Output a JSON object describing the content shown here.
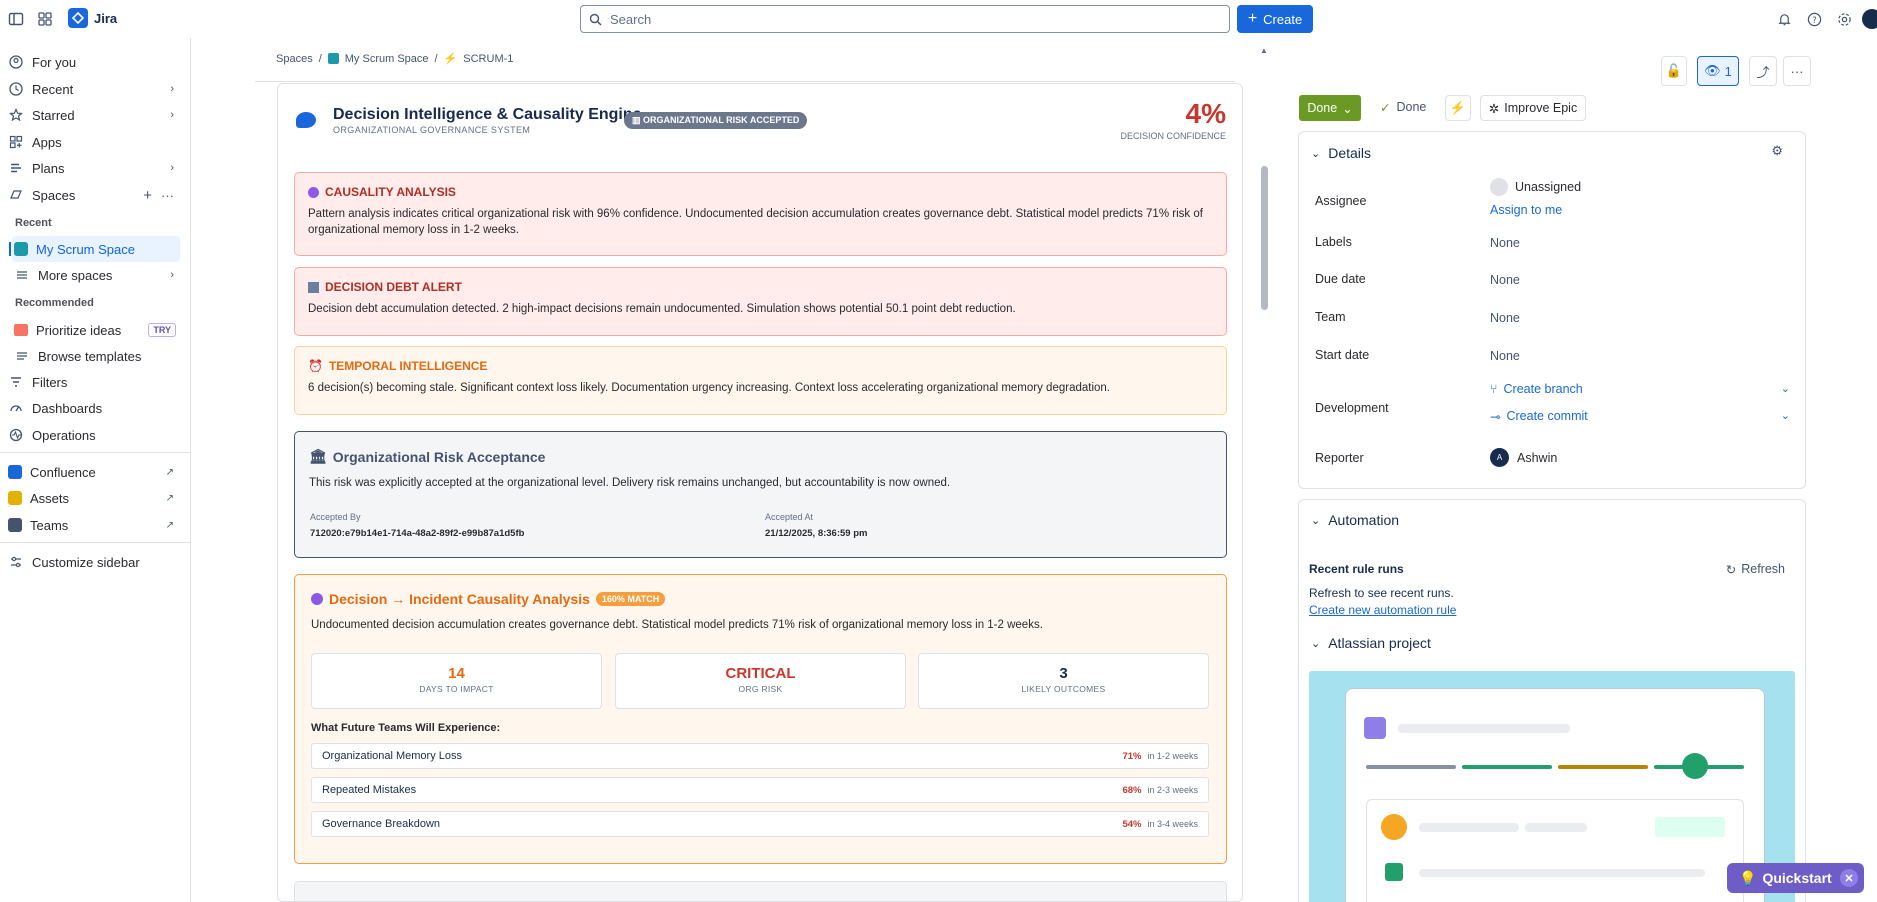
{
  "topbar": {
    "app_name": "Jira",
    "search_placeholder": "Search",
    "create_label": "Create"
  },
  "sidebar": {
    "items": [
      {
        "label": "For you"
      },
      {
        "label": "Recent"
      },
      {
        "label": "Starred"
      },
      {
        "label": "Apps"
      },
      {
        "label": "Plans"
      },
      {
        "label": "Spaces"
      }
    ],
    "recent_heading": "Recent",
    "recent_space": "My Scrum Space",
    "more_spaces": "More spaces",
    "recommended_heading": "Recommended",
    "prioritize": "Prioritize ideas",
    "try_badge": "TRY",
    "browse_templates": "Browse templates",
    "filters": "Filters",
    "dashboards": "Dashboards",
    "operations": "Operations",
    "confluence": "Confluence",
    "assets": "Assets",
    "teams": "Teams",
    "customize": "Customize sidebar"
  },
  "breadcrumb": {
    "spaces": "Spaces",
    "space": "My Scrum Space",
    "issue": "SCRUM-1"
  },
  "header": {
    "title": "Decision Intelligence & Causality Engine",
    "subtitle": "ORGANIZATIONAL GOVERNANCE SYSTEM",
    "badge": "ORGANIZATIONAL RISK ACCEPTED",
    "confidence": "4%",
    "confidence_label": "DECISION CONFIDENCE"
  },
  "causality": {
    "title": "CAUSALITY ANALYSIS",
    "text": "Pattern analysis indicates critical organizational risk with 96% confidence. Undocumented decision accumulation creates governance debt. Statistical model predicts 71% risk of organizational memory loss in 1-2 weeks."
  },
  "debt": {
    "title": "DECISION DEBT ALERT",
    "text": "Decision debt accumulation detected. 2 high-impact decisions remain undocumented. Simulation shows potential 50.1 point debt reduction."
  },
  "temporal": {
    "title": "TEMPORAL INTELLIGENCE",
    "text": "6 decision(s) becoming stale. Significant context loss likely. Documentation urgency increasing. Context loss accelerating organizational memory degradation."
  },
  "risk": {
    "title": "Organizational Risk Acceptance",
    "text": "This risk was explicitly accepted at the organizational level. Delivery risk remains unchanged, but accountability is now owned.",
    "accepted_by_label": "Accepted By",
    "accepted_by": "712020:e79b14e1-714a-48a2-89f2-e99b87a1d5fb",
    "accepted_at_label": "Accepted At",
    "accepted_at": "21/12/2025, 8:36:59 pm"
  },
  "incident": {
    "title": "Decision → Incident Causality Analysis",
    "badge": "160% MATCH",
    "text": "Undocumented decision accumulation creates governance debt. Statistical model predicts 71% risk of organizational memory loss in 1-2 weeks.",
    "metrics": [
      {
        "value": "14",
        "label": "DAYS TO IMPACT",
        "color": "#e56910"
      },
      {
        "value": "CRITICAL",
        "label": "ORG RISK",
        "color": "#c9372c"
      },
      {
        "value": "3",
        "label": "LIKELY OUTCOMES",
        "color": "#172b4d"
      }
    ],
    "future_heading": "What Future Teams Will Experience:",
    "future": [
      {
        "name": "Organizational Memory Loss",
        "pct": "71%",
        "when": "in 1-2 weeks"
      },
      {
        "name": "Repeated Mistakes",
        "pct": "68%",
        "when": "in 2-3 weeks"
      },
      {
        "name": "Governance Breakdown",
        "pct": "54%",
        "when": "in 3-4 weeks"
      }
    ]
  },
  "right": {
    "watch_count": "1",
    "status_btn": "Done",
    "status_done": "Done",
    "improve": "Improve Epic",
    "details_heading": "Details",
    "assignee_label": "Assignee",
    "assignee": "Unassigned",
    "assign_to_me": "Assign to me",
    "labels_label": "Labels",
    "labels": "None",
    "due_label": "Due date",
    "due": "None",
    "team_label": "Team",
    "team": "None",
    "start_label": "Start date",
    "start": "None",
    "dev_label": "Development",
    "create_branch": "Create branch",
    "create_commit": "Create commit",
    "reporter_label": "Reporter",
    "reporter_initial": "A",
    "reporter": "Ashwin",
    "automation_heading": "Automation",
    "recent_runs": "Recent rule runs",
    "refresh": "Refresh",
    "refresh_hint": "Refresh to see recent runs.",
    "create_rule": "Create new automation rule",
    "atlassian_heading": "Atlassian project"
  },
  "quickstart": "Quickstart"
}
